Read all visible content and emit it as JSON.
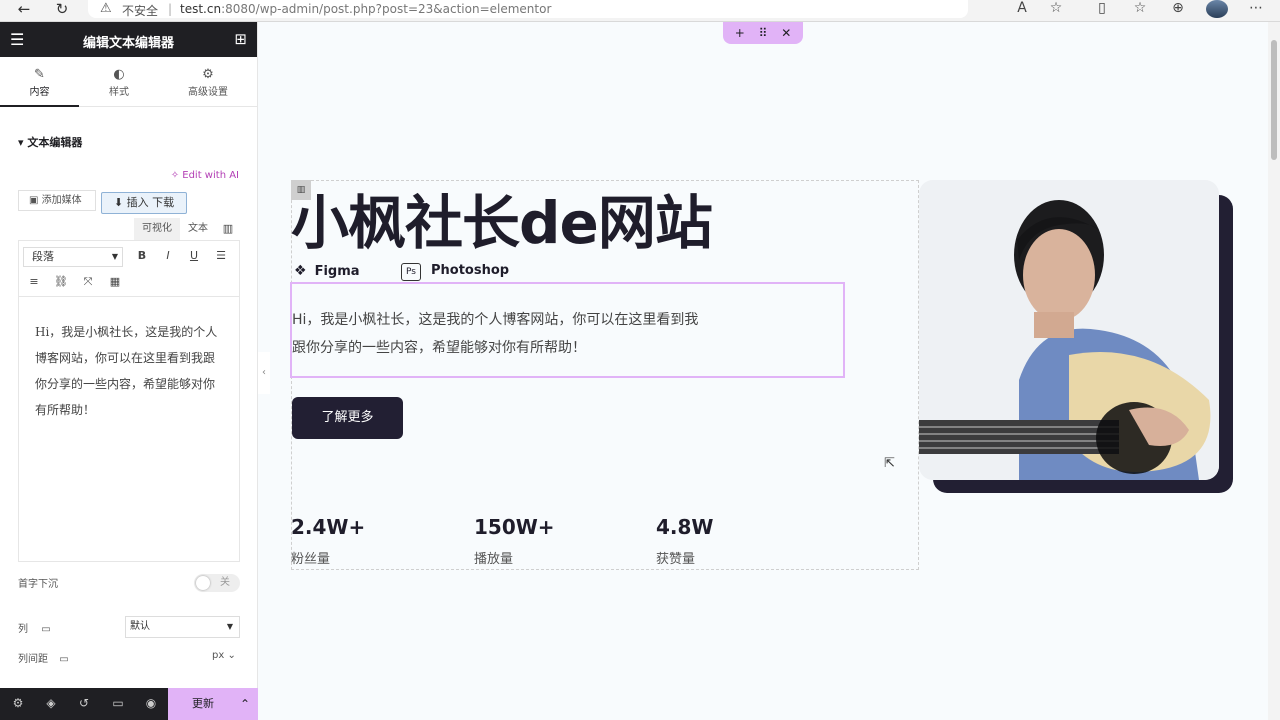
{
  "browser": {
    "insecure_label": "不安全",
    "url_host": "test.cn",
    "url_rest": ":8080/wp-admin/post.php?post=23&action=elementor"
  },
  "panel": {
    "title": "编辑文本编辑器",
    "tabs": [
      {
        "label": "内容"
      },
      {
        "label": "样式"
      },
      {
        "label": "高级设置"
      }
    ],
    "section_title": "文本编辑器",
    "edit_ai": "Edit with AI",
    "add_media": "添加媒体",
    "insert_download": "插入 下载",
    "mode_visual": "可视化",
    "mode_text": "文本",
    "format_select": "段落",
    "editor_content": "Hi，我是小枫社长，这是我的个人博客网站，你可以在这里看到我跟你分享的一些内容，希望能够对你有所帮助！",
    "drop_cap_label": "首字下沉",
    "drop_cap_state": "关",
    "columns_label": "列",
    "columns_value": "默认",
    "column_gap_label": "列间距",
    "column_gap_unit": "px",
    "update_button": "更新"
  },
  "page": {
    "headline": "小枫社长de网站",
    "skills": [
      {
        "icon": "figma-icon",
        "label": "Figma"
      },
      {
        "icon": "photoshop-icon",
        "label": "Photoshop",
        "badge": "Ps"
      }
    ],
    "intro_line1": "Hi，我是小枫社长，这是我的个人博客网站，你可以在这里看到我",
    "intro_line2": "跟你分享的一些内容，希望能够对你有所帮助！",
    "cta": "了解更多",
    "stats": [
      {
        "value": "2.4W+",
        "label": "粉丝量"
      },
      {
        "value": "150W+",
        "label": "播放量"
      },
      {
        "value": "4.8W",
        "label": "获赞量"
      }
    ]
  },
  "colors": {
    "accent": "#e1b3f7",
    "dark": "#221f33",
    "ai": "#b33fb5"
  }
}
